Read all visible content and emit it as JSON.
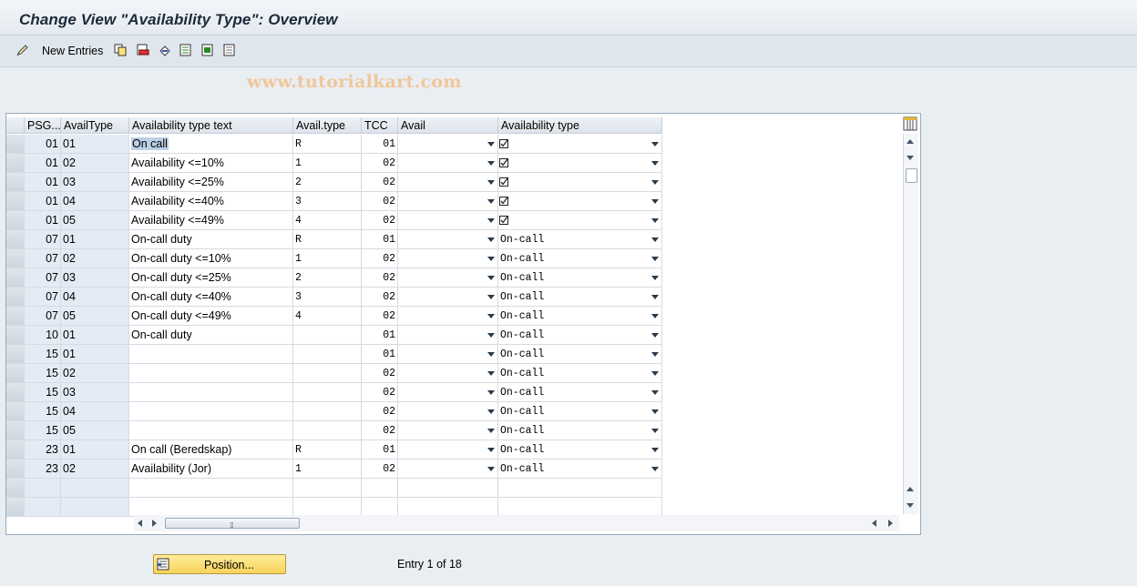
{
  "window": {
    "title": "Change View \"Availability Type\": Overview"
  },
  "toolbar": {
    "new_entries_label": "New Entries",
    "icons": [
      "change-pencil-icon",
      "copy-icon",
      "delete-icon",
      "undo-icon",
      "select-all-icon",
      "select-block-icon",
      "deselect-all-icon"
    ]
  },
  "watermark": "www.tutorialkart.com",
  "table": {
    "headers": [
      "PSG...",
      "AvailType",
      "Availability type text",
      "Avail.type",
      "TCC",
      "Avail",
      "Availability type"
    ],
    "rows": [
      {
        "psg": "01",
        "avail_type": "01",
        "text": "On call",
        "avail_type2": "R",
        "tcc": "01",
        "avail": "",
        "availability_type": "",
        "checked": true
      },
      {
        "psg": "01",
        "avail_type": "02",
        "text": "Availability <=10%",
        "avail_type2": "1",
        "tcc": "02",
        "avail": "",
        "availability_type": "",
        "checked": true
      },
      {
        "psg": "01",
        "avail_type": "03",
        "text": "Availability <=25%",
        "avail_type2": "2",
        "tcc": "02",
        "avail": "",
        "availability_type": "",
        "checked": true
      },
      {
        "psg": "01",
        "avail_type": "04",
        "text": "Availability <=40%",
        "avail_type2": "3",
        "tcc": "02",
        "avail": "",
        "availability_type": "",
        "checked": true
      },
      {
        "psg": "01",
        "avail_type": "05",
        "text": "Availability <=49%",
        "avail_type2": "4",
        "tcc": "02",
        "avail": "",
        "availability_type": "",
        "checked": true
      },
      {
        "psg": "07",
        "avail_type": "01",
        "text": "On-call duty",
        "avail_type2": "R",
        "tcc": "01",
        "avail": "",
        "availability_type": "On-call",
        "checked": false
      },
      {
        "psg": "07",
        "avail_type": "02",
        "text": "On-call duty <=10%",
        "avail_type2": "1",
        "tcc": "02",
        "avail": "",
        "availability_type": "On-call",
        "checked": false
      },
      {
        "psg": "07",
        "avail_type": "03",
        "text": "On-call duty <=25%",
        "avail_type2": "2",
        "tcc": "02",
        "avail": "",
        "availability_type": "On-call",
        "checked": false
      },
      {
        "psg": "07",
        "avail_type": "04",
        "text": "On-call duty <=40%",
        "avail_type2": "3",
        "tcc": "02",
        "avail": "",
        "availability_type": "On-call",
        "checked": false
      },
      {
        "psg": "07",
        "avail_type": "05",
        "text": "On-call duty <=49%",
        "avail_type2": "4",
        "tcc": "02",
        "avail": "",
        "availability_type": "On-call",
        "checked": false
      },
      {
        "psg": "10",
        "avail_type": "01",
        "text": "On-call duty",
        "avail_type2": "",
        "tcc": "01",
        "avail": "",
        "availability_type": "On-call",
        "checked": false
      },
      {
        "psg": "15",
        "avail_type": "01",
        "text": "",
        "avail_type2": "",
        "tcc": "01",
        "avail": "",
        "availability_type": "On-call",
        "checked": false
      },
      {
        "psg": "15",
        "avail_type": "02",
        "text": "",
        "avail_type2": "",
        "tcc": "02",
        "avail": "",
        "availability_type": "On-call",
        "checked": false
      },
      {
        "psg": "15",
        "avail_type": "03",
        "text": "",
        "avail_type2": "",
        "tcc": "02",
        "avail": "",
        "availability_type": "On-call",
        "checked": false
      },
      {
        "psg": "15",
        "avail_type": "04",
        "text": "",
        "avail_type2": "",
        "tcc": "02",
        "avail": "",
        "availability_type": "On-call",
        "checked": false
      },
      {
        "psg": "15",
        "avail_type": "05",
        "text": "",
        "avail_type2": "",
        "tcc": "02",
        "avail": "",
        "availability_type": "On-call",
        "checked": false
      },
      {
        "psg": "23",
        "avail_type": "01",
        "text": "On call (Beredskap)",
        "avail_type2": "R",
        "tcc": "01",
        "avail": "",
        "availability_type": "On-call",
        "checked": false
      },
      {
        "psg": "23",
        "avail_type": "02",
        "text": "Availability (Jor)",
        "avail_type2": "1",
        "tcc": "02",
        "avail": "",
        "availability_type": "On-call",
        "checked": false
      }
    ],
    "empty_rows": 2
  },
  "footer": {
    "position_button_label": "Position...",
    "entry_info": "Entry 1 of 18"
  },
  "colors": {
    "key_column": "#e3ecf5",
    "position_button": "#f7d35a",
    "watermark": "#f0c79a"
  }
}
